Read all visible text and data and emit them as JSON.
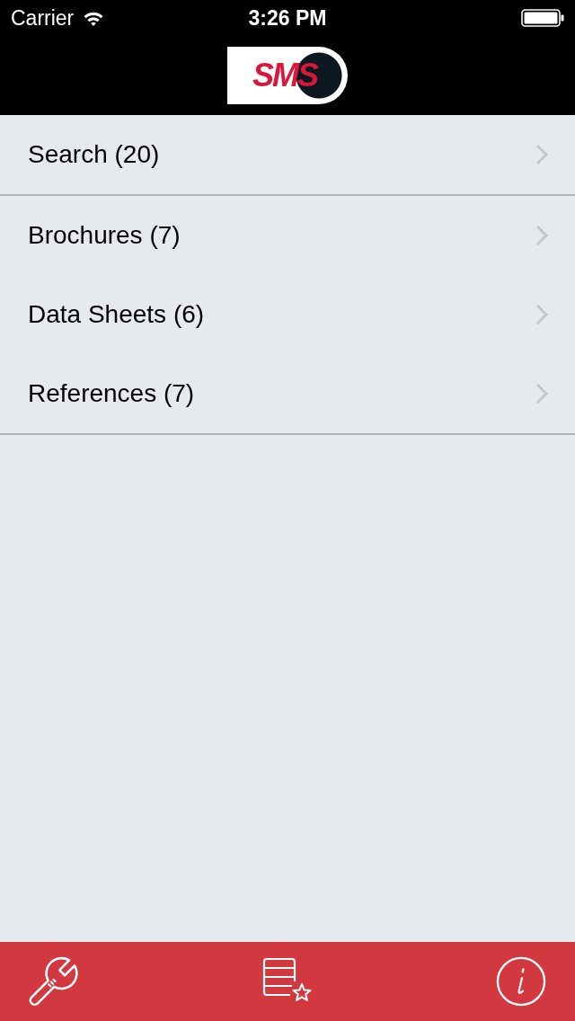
{
  "status_bar": {
    "carrier": "Carrier",
    "time": "3:26 PM"
  },
  "nav_bar": {
    "logo_text": "SMS"
  },
  "menu": {
    "sections": [
      {
        "items": [
          {
            "label": "Search (20)"
          }
        ]
      },
      {
        "items": [
          {
            "label": "Brochures (7)"
          },
          {
            "label": "Data Sheets (6)"
          },
          {
            "label": "References (7)"
          }
        ]
      }
    ]
  },
  "tab_bar": {
    "items": [
      {
        "kind": "wrench"
      },
      {
        "kind": "list-star"
      },
      {
        "kind": "info"
      }
    ]
  }
}
